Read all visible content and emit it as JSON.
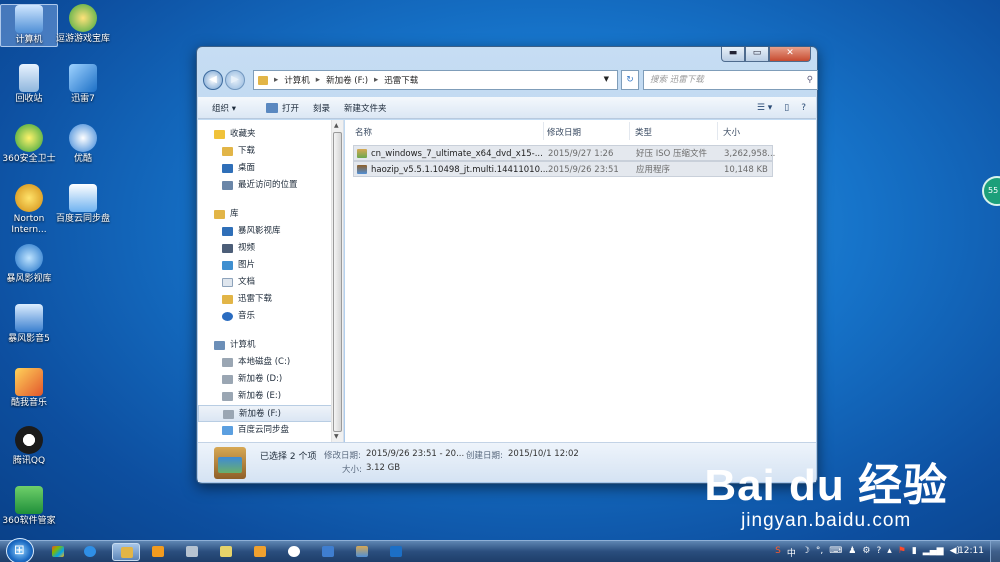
{
  "desktop": {
    "icons": [
      {
        "label": "计算机"
      },
      {
        "label": "逗游游戏宝库"
      },
      {
        "label": "回收站"
      },
      {
        "label": "迅雷7"
      },
      {
        "label": "360安全卫士"
      },
      {
        "label": "优酷"
      },
      {
        "label": "Norton Intern..."
      },
      {
        "label": "百度云同步盘"
      },
      {
        "label": "暴风影视库"
      },
      {
        "label": "暴风影音5"
      },
      {
        "label": "酷我音乐"
      },
      {
        "label": "腾讯QQ"
      },
      {
        "label": "360软件管家"
      }
    ],
    "gadget_text": "55"
  },
  "window": {
    "caption_buttons": {
      "minimize": "▬",
      "maximize": "▭",
      "close": "✕"
    },
    "address": {
      "path": [
        "计算机",
        "新加卷 (F:)",
        "迅雷下载"
      ],
      "separator": "▸"
    },
    "search": {
      "placeholder": "搜索 迅雷下载"
    },
    "toolbar": {
      "organize": "组织 ▾",
      "open": "打开",
      "burn": "刻录",
      "new_folder": "新建文件夹"
    },
    "nav": {
      "favorites_header": "收藏夹",
      "favorites": [
        {
          "label": "下载"
        },
        {
          "label": "桌面"
        },
        {
          "label": "最近访问的位置"
        }
      ],
      "libraries_header": "库",
      "libraries": [
        {
          "label": "暴风影视库"
        },
        {
          "label": "视频"
        },
        {
          "label": "图片"
        },
        {
          "label": "文档"
        },
        {
          "label": "迅雷下载"
        },
        {
          "label": "音乐"
        }
      ],
      "computer_header": "计算机",
      "drives": [
        {
          "label": "本地磁盘 (C:)"
        },
        {
          "label": "新加卷 (D:)"
        },
        {
          "label": "新加卷 (E:)"
        },
        {
          "label": "新加卷 (F:)"
        },
        {
          "label": "百度云同步盘"
        }
      ]
    },
    "columns": {
      "name": "名称",
      "date": "修改日期",
      "type": "类型",
      "size": "大小"
    },
    "files": [
      {
        "name": "cn_windows_7_ultimate_x64_dvd_x15-...",
        "date": "2015/9/27 1:26",
        "type": "好压 ISO 压缩文件",
        "size": "3,262,958..."
      },
      {
        "name": "haozip_v5.5.1.10498_jt.multi.14411010...",
        "date": "2015/9/26 23:51",
        "type": "应用程序",
        "size": "10,148 KB"
      }
    ],
    "details": {
      "selected": "已选择 2 个项",
      "modified_label": "修改日期:",
      "modified_value": "2015/9/26 23:51 - 20...",
      "created_label": "创建日期:",
      "created_value": "2015/10/1 12:02",
      "size_label": "大小:",
      "size_value": "3.12 GB"
    }
  },
  "taskbar": {
    "tray_text": "中",
    "clock": "12:11"
  },
  "watermark": {
    "brand": "Bai du 经验",
    "url": "jingyan.baidu.com"
  }
}
